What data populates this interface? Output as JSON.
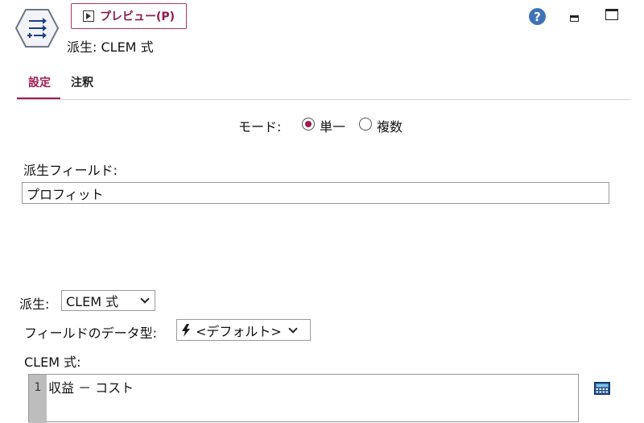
{
  "header": {
    "preview_button_label": "プレビュー(P)",
    "node_title": "派生: CLEM 式",
    "help_glyph": "?"
  },
  "tabs": [
    {
      "label": "設定",
      "active": true
    },
    {
      "label": "注釈",
      "active": false
    }
  ],
  "mode": {
    "label": "モード:",
    "options": [
      {
        "label": "単一",
        "selected": true
      },
      {
        "label": "複数",
        "selected": false
      }
    ]
  },
  "derive_field": {
    "label": "派生フィールド:",
    "value": "プロフィット"
  },
  "derive_as": {
    "label": "派生:",
    "selected": "CLEM 式"
  },
  "field_type": {
    "label": "フィールドのデータ型:",
    "selected": "<デフォルト>"
  },
  "clem_expression": {
    "label": "CLEM 式:",
    "line_number": "1",
    "code": "収益 － コスト"
  },
  "icons": {
    "node": "derive-node-icon",
    "preview": "play-icon",
    "help": "help-icon",
    "minimize": "minimize-icon",
    "maximize": "maximize-icon",
    "type": "lightning-bolt-icon",
    "expression_builder": "calculator-icon"
  },
  "colors": {
    "accent": "#a01a54",
    "help_blue": "#3e73b9"
  }
}
